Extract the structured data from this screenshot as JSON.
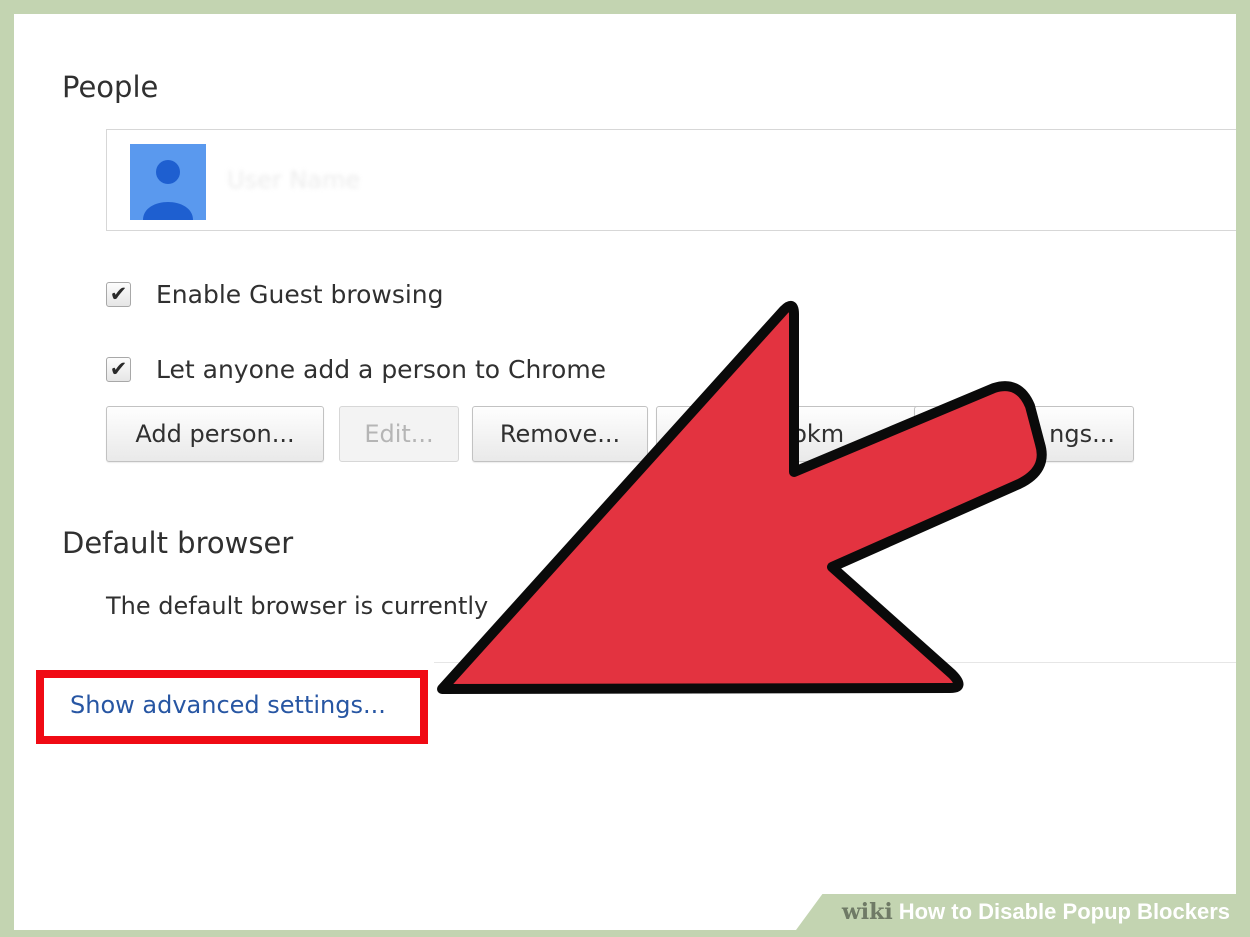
{
  "people": {
    "title": "People",
    "profile_name": "User Name"
  },
  "checkboxes": [
    {
      "label": "Enable Guest browsing",
      "checked": true
    },
    {
      "label": "Let anyone add a person to Chrome",
      "checked": true
    }
  ],
  "buttons": {
    "add_person": "Add person...",
    "edit": "Edit...",
    "remove": "Remove...",
    "import_partial": "Import bookm",
    "settings_partial": "ngs..."
  },
  "check_glyph": "✔",
  "default_browser": {
    "title": "Default browser",
    "text": "The default browser is currently"
  },
  "advanced_link": "Show advanced settings...",
  "annotation": {
    "arrow_color": "#e33340",
    "highlight_color": "#f00a14"
  },
  "watermark": {
    "brand": "wiki",
    "title": "How to Disable Popup Blockers"
  }
}
